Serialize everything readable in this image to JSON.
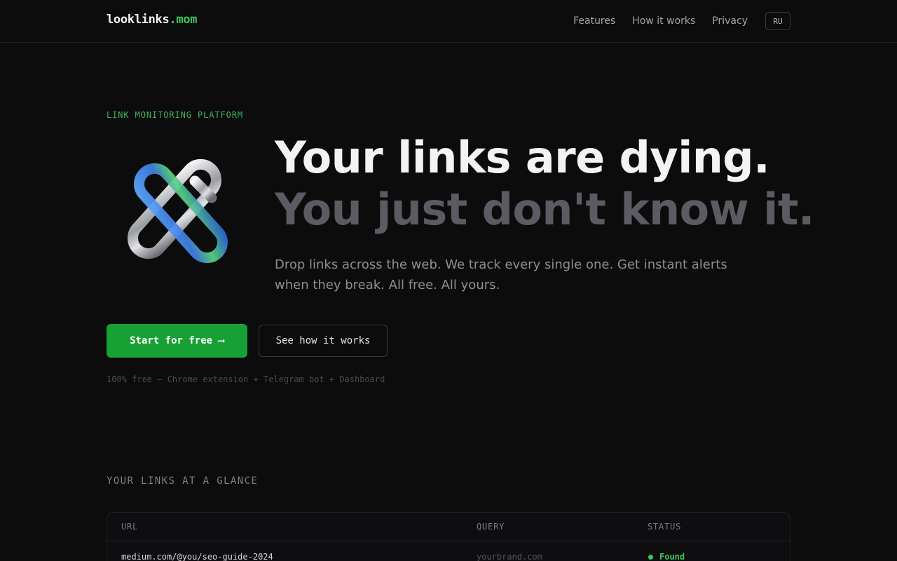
{
  "brand": {
    "name": "looklinks",
    "tld": ".mom",
    "accent": "#3ec45a"
  },
  "nav": {
    "items": [
      "Features",
      "How it works",
      "Privacy"
    ],
    "lang": "RU"
  },
  "hero": {
    "eyebrow": "LINK MONITORING PLATFORM",
    "headline_1": "Your links are dying.",
    "headline_2": "You just don't know it.",
    "lead": "Drop links across the web. We track every single one. Get instant alerts when they break. All free. All yours.",
    "cta_primary": "Start for free ⟶",
    "cta_secondary": "See how it works",
    "fineprint": "100% free — Chrome extension + Telegram bot + Dashboard",
    "icon": "chain-link-icon"
  },
  "glance": {
    "label": "YOUR LINKS AT A GLANCE",
    "columns": [
      "URL",
      "QUERY",
      "STATUS"
    ],
    "rows": [
      {
        "url": "medium.com/@you/seo-guide-2024",
        "query": "yourbrand.com",
        "status": "Found",
        "status_color": "#3fc55c"
      }
    ]
  }
}
